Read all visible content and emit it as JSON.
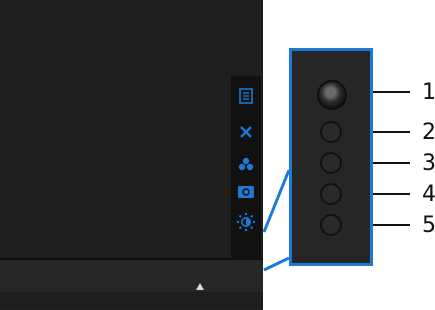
{
  "colors": {
    "accent": "#1e78d6",
    "screen": "#1c1c1c",
    "panel": "#262626"
  },
  "menu_icons": [
    {
      "name": "menu-icon"
    },
    {
      "name": "close-icon"
    },
    {
      "name": "color-icon"
    },
    {
      "name": "input-source-icon"
    },
    {
      "name": "brightness-contrast-icon"
    }
  ],
  "labels": {
    "joystick": "1",
    "button2": "2",
    "button3": "3",
    "button4": "4",
    "button5": "5"
  }
}
